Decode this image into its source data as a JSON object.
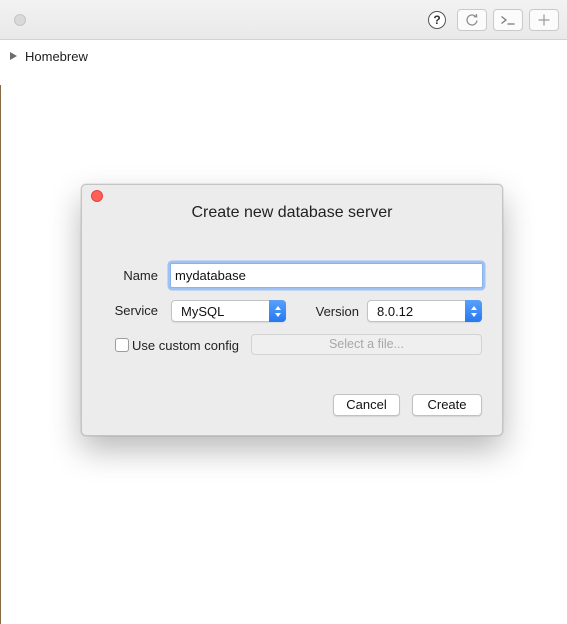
{
  "sidebar": {
    "items": [
      {
        "label": "Homebrew"
      }
    ]
  },
  "toolbar": {
    "help_symbol": "?"
  },
  "dialog": {
    "title": "Create new database server",
    "name_label": "Name",
    "name_value": "mydatabase",
    "service_label": "Service",
    "service_value": "MySQL",
    "version_label": "Version",
    "version_value": "8.0.12",
    "custom_config_label": "Use custom config",
    "custom_config_checked": false,
    "select_file_label": "Select a file...",
    "cancel_label": "Cancel",
    "create_label": "Create"
  },
  "colors": {
    "accent": "#2f80f3",
    "close": "#ff5f57",
    "focus_ring": "#9ec2f3",
    "dialog_bg": "#ececec"
  },
  "icons": [
    "window-button-icon",
    "help-icon",
    "refresh-icon",
    "terminal-icon",
    "add-icon",
    "disclosure-triangle-icon",
    "close-icon",
    "stepper-arrows-icon",
    "checkbox-icon"
  ]
}
